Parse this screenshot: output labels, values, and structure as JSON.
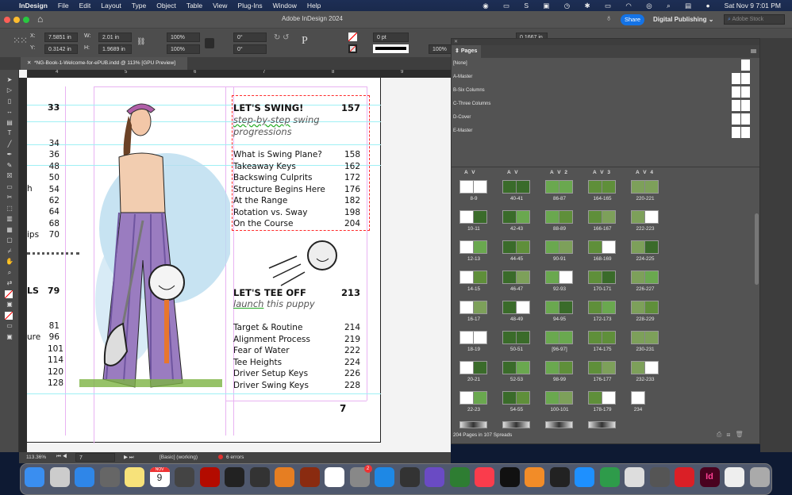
{
  "menubar": {
    "app": "InDesign",
    "items": [
      "File",
      "Edit",
      "Layout",
      "Type",
      "Object",
      "Table",
      "View",
      "Plug-Ins",
      "Window",
      "Help"
    ],
    "clock": "Sat Nov 9  7:01 PM"
  },
  "titlebar": {
    "title": "Adobe InDesign 2024",
    "share": "Share",
    "workspace": "Digital Publishing",
    "stock_placeholder": "Adobe Stock"
  },
  "control": {
    "x_label": "X:",
    "x": "7.5851 in",
    "y_label": "Y:",
    "y": "0.3142 in",
    "w_label": "W:",
    "w": "2.01 in",
    "h_label": "H:",
    "h": "1.9689 in",
    "scale_x": "100%",
    "scale_y": "100%",
    "rotate": "0°",
    "shear": "0°",
    "stroke": "0 pt",
    "opacity": "100%",
    "gutter": "0.1667 in"
  },
  "document_tab": {
    "title": "*NG-Book-1-Welcome-for-ePUB.indd @ 113% [GPU Preview]"
  },
  "ruler": [
    "4",
    "5",
    "6",
    "7",
    "8",
    "9"
  ],
  "left_toc": {
    "n33": "33",
    "nums": [
      "34",
      "36",
      "48",
      "50",
      "54",
      "62",
      "64",
      "68",
      "70"
    ],
    "frag_h": "h",
    "frag_ips": "ips",
    "ls": "LS",
    "n79": "79",
    "nums2": [
      "81",
      "96",
      "101",
      "114",
      "120",
      "128"
    ],
    "frag_ure": "ure"
  },
  "toc1": {
    "heading": "LET'S SWING!",
    "page": "157",
    "subtitle1": "step-by-step",
    "subtitle2": " swing",
    "subtitle3": "progressions",
    "items": [
      {
        "t": "What is Swing Plane?",
        "p": "158"
      },
      {
        "t": "Takeaway Keys",
        "p": "162"
      },
      {
        "t": "Backswing Culprits",
        "p": "172"
      },
      {
        "t": "Structure Begins Here",
        "p": "176"
      },
      {
        "t": "At the Range",
        "p": "182"
      },
      {
        "t": "Rotation vs. Sway",
        "p": "198"
      },
      {
        "t": "On the Course",
        "p": "204"
      }
    ]
  },
  "toc2": {
    "heading": "LET'S TEE OFF",
    "page": "213",
    "subtitle1": "launch",
    "subtitle2": " this puppy",
    "items": [
      {
        "t": "Target & Routine",
        "p": "214"
      },
      {
        "t": "Alignment Process",
        "p": "219"
      },
      {
        "t": "Fear of Water",
        "p": "222"
      },
      {
        "t": "Tee Heights",
        "p": "224"
      },
      {
        "t": "Driver Setup Keys",
        "p": "226"
      },
      {
        "t": "Driver Swing Keys",
        "p": "228"
      }
    ]
  },
  "page_number": "7",
  "pages_panel": {
    "title": "Pages",
    "masters": [
      "[None]",
      "A-Master",
      "B-Six Columns",
      "C-Three Columns",
      "D-Cover",
      "E-Master"
    ],
    "columns": [
      "A V",
      "A V",
      "A V 2",
      "A V 3",
      "A V 4"
    ],
    "spreads": [
      [
        "8-9",
        "10-11",
        "12-13",
        "14-15",
        "16-17",
        "18-19",
        "20-21",
        "22-23"
      ],
      [
        "40-41",
        "42-43",
        "44-45",
        "46-47",
        "48-49",
        "50-51",
        "52-53",
        "54-55"
      ],
      [
        "86-87",
        "88-89",
        "90-91",
        "92-93",
        "94-95",
        "[96-97]",
        "98-99",
        "100-101"
      ],
      [
        "164-165",
        "166-167",
        "168-169",
        "170-171",
        "172-173",
        "174-175",
        "176-177",
        "178-179"
      ],
      [
        "220-221",
        "222-223",
        "224-225",
        "226-227",
        "228-229",
        "230-231",
        "232-233",
        "234"
      ]
    ],
    "footer": "204 Pages in 107 Spreads"
  },
  "status": {
    "zoom": "113.36%",
    "page": "7",
    "style": "[Basic] (working)",
    "errors": "6 errors",
    "error_color": "#e0312f"
  },
  "dock": {
    "calendar_month": "NOV",
    "calendar_day": "9",
    "badge": "2"
  },
  "colors": {
    "accent": "#1473e6",
    "frame": "#ff2a2a",
    "margin": "#e8b3f2",
    "guide": "#9ff0f5"
  }
}
